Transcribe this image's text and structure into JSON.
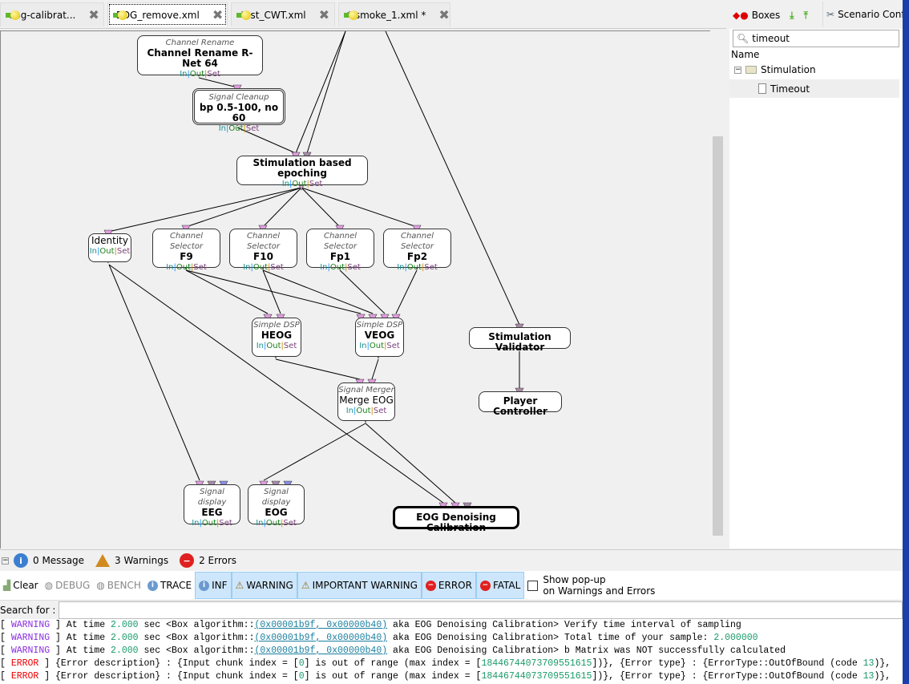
{
  "tabs": [
    {
      "label": "eog-calibrat..."
    },
    {
      "label": "EOG_remove.xml"
    },
    {
      "label": "test_CWT.xml"
    },
    {
      "label": "* smoke_1.xml *"
    }
  ],
  "boxes": {
    "rename": {
      "type": "Channel Rename",
      "name": "Channel Rename R-Net 64"
    },
    "cleanup": {
      "type": "Signal Cleanup",
      "name": "bp 0.5-100, no 60"
    },
    "epoching": {
      "name": "Stimulation based epoching"
    },
    "identity": {
      "name": "Identity"
    },
    "f9": {
      "type": "Channel Selector",
      "name": "F9"
    },
    "f10": {
      "type": "Channel Selector",
      "name": "F10"
    },
    "fp1": {
      "type": "Channel Selector",
      "name": "Fp1"
    },
    "fp2": {
      "type": "Channel Selector",
      "name": "Fp2"
    },
    "heog": {
      "type": "Simple DSP",
      "name": "HEOG"
    },
    "veog": {
      "type": "Simple DSP",
      "name": "VEOG"
    },
    "merge": {
      "type": "Signal Merger",
      "name": "Merge EOG"
    },
    "validator": {
      "name": "Stimulation Validator"
    },
    "player": {
      "name": "Player Controller"
    },
    "eeg": {
      "type": "Signal display",
      "name": "EEG"
    },
    "eog": {
      "type": "Signal display",
      "name": "EOG"
    },
    "denoise": {
      "name": "EOG Denoising Calibration"
    }
  },
  "io": {
    "in": "In",
    "out": "Out",
    "set": "Set"
  },
  "right": {
    "tab_boxes": "Boxes",
    "tab_config": "Scenario Confi",
    "search_value": "timeout",
    "column": "Name",
    "tree": [
      {
        "label": "Stimulation",
        "children": [
          {
            "label": "Timeout"
          }
        ]
      }
    ]
  },
  "console": {
    "messages": "0 Message",
    "warnings": "3 Warnings",
    "errors": "2 Errors",
    "filters": {
      "clear": "Clear",
      "debug": "DEBUG",
      "bench": "BENCH",
      "trace": "TRACE",
      "inf": "INF",
      "warning": "WARNING",
      "important": "IMPORTANT WARNING",
      "error": "ERROR",
      "fatal": "FATAL"
    },
    "popup_label_1": "Show pop-up",
    "popup_label_2": "on Warnings and Errors",
    "popup_checked": false,
    "search_label": "Search for :",
    "search_value": "",
    "lines": [
      {
        "level": "WARNING",
        "pre": " ] At time ",
        "time": "2.000",
        "mid": " sec <Box algorithm::",
        "id": "(0x00001b9f, 0x00000b40)",
        "post": " aka EOG Denoising Calibration> Verify time interval of sampling",
        "num": "",
        "tail": ""
      },
      {
        "level": "WARNING",
        "pre": " ] At time ",
        "time": "2.000",
        "mid": " sec <Box algorithm::",
        "id": "(0x00001b9f, 0x00000b40)",
        "post": " aka EOG Denoising Calibration> Total time of your sample: ",
        "num": "2.000000",
        "tail": ""
      },
      {
        "level": "WARNING",
        "pre": " ] At time ",
        "time": "2.000",
        "mid": " sec <Box algorithm::",
        "id": "(0x00001b9f, 0x00000b40)",
        "post": " aka EOG Denoising Calibration> b Matrix was NOT successfully calculated",
        "num": "",
        "tail": ""
      },
      {
        "level": "ERROR",
        "text1": " ] {Error description} : {Input chunk index = [",
        "n1": "0",
        "text2": "] is out of range (max index = [",
        "n2": "18446744073709551615",
        "text3": "])}, {Error type} : {ErrorType::OutOfBound (code ",
        "n3": "13",
        "text4": ")},"
      },
      {
        "level": "ERROR",
        "text1": " ] {Error description} : {Input chunk index = [",
        "n1": "0",
        "text2": "] is out of range (max index = [",
        "n2": "18446744073709551615",
        "text3": "])}, {Error type} : {ErrorType::OutOfBound (code ",
        "n3": "13",
        "text4": ")},"
      }
    ]
  },
  "colors": {
    "input_pink": "#e09ade",
    "input_mauve": "#a78aa6",
    "input_blue": "#8a8ae6",
    "filter_on": "#cde6fb",
    "warning": "#8a2be2",
    "error": "#e00000"
  }
}
